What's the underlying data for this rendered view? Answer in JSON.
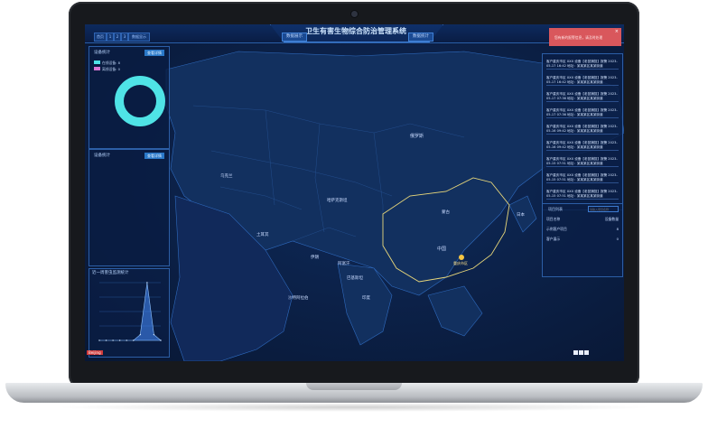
{
  "app": {
    "title": "卫生有害生物综合防治管理系统"
  },
  "topbar": {
    "tabs": [
      "数据展示",
      "数据统计"
    ],
    "mini_buttons": [
      "首页",
      "1",
      "2",
      "3",
      "数据显示"
    ]
  },
  "left_panels": {
    "pie_panel": {
      "title": "设备统计",
      "button": "查看详情",
      "legend": [
        {
          "label": "在线设备: 8",
          "color": "#4fe3e6"
        },
        {
          "label": "离线设备: 0",
          "color": "#d977d2"
        }
      ]
    },
    "list_panel": {
      "title": "设备统计",
      "button": "查看详情"
    },
    "chart_panel": {
      "title": "近一周害虫监测统计"
    }
  },
  "alert_box": {
    "text": "您有新的报警信息，请及时处理"
  },
  "alerts": [
    "客户重庆市区 XXX 设备【老鼠捕捉】报警 2023-05-17 16:42 地址：某某某区某某街道",
    "客户重庆市区 XXX 设备【老鼠捕捉】报警 2023-05-17 16:42 地址：某某某区某某街道",
    "客户重庆市区 XXX 设备【老鼠捕捉】报警 2023-05-17 07:36 地址：某某某区某某街道",
    "客户重庆市区 XXX 设备【老鼠捕捉】报警 2023-05-17 07:36 地址：某某某区某某街道",
    "客户重庆市区 XXX 设备【老鼠捕捉】报警 2023-05-16 09:42 地址：某某某区某某街道",
    "客户重庆市区 XXX 设备【老鼠捕捉】报警 2023-05-16 09:42 地址：某某某区某某街道",
    "客户重庆市区 XXX 设备【老鼠捕捉】报警 2023-05-15 07:51 地址：某某某区某某街道",
    "客户重庆市区 XXX 设备【老鼠捕捉】报警 2023-05-15 07:51 地址：某某某区某某街道",
    "客户重庆市区 XXX 设备【老鼠捕捉】报警 2023-05-15 07:51 地址：某某某区某某街道"
  ],
  "select_panel": {
    "title": "项目列表",
    "search_placeholder": "请输入项目名称",
    "headers": [
      "项目名称",
      "设备数量"
    ],
    "rows": [
      {
        "name": "示例客户项目",
        "count": "8"
      },
      {
        "name": "客户展示",
        "count": "0"
      }
    ]
  },
  "map": {
    "labels": [
      "俄罗斯",
      "哈萨克斯坦",
      "蒙古",
      "中国",
      "印度",
      "伊朗",
      "土耳其",
      "沙特阿拉伯",
      "日本",
      "乌克兰",
      "巴基斯坦",
      "阿富汗"
    ],
    "marker_label": "重庆市区"
  },
  "chart_data": {
    "type": "area",
    "title": "",
    "x": [
      "",
      "",
      "",
      "",
      "",
      "",
      "",
      "",
      "",
      ""
    ],
    "series": [
      {
        "values": [
          0,
          0,
          0,
          0,
          0,
          0,
          1,
          10,
          1,
          0
        ]
      }
    ],
    "ylim": [
      0,
      10
    ]
  },
  "badge": {
    "text": "Beijing"
  }
}
